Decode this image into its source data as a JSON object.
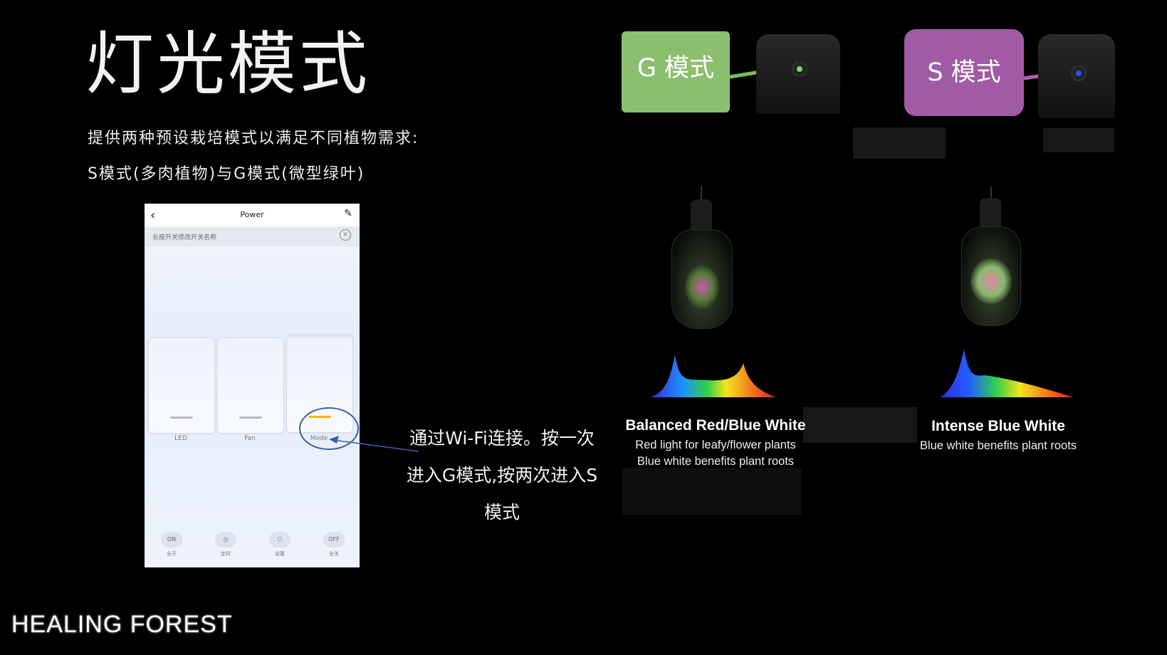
{
  "slide": {
    "title": "灯光模式",
    "subtitle_line1": "提供两种预设栽培模式以满足不同植物需求:",
    "subtitle_line2": "S模式(多肉植物)与G模式(微型绿叶)",
    "annotation": "通过Wi-Fi连接。按一次进入G模式,按两次进入S模式",
    "logo": "HEALING FOREST"
  },
  "phone": {
    "title": "Power",
    "hint": "长按开关修改开关名称",
    "switches": [
      {
        "label": "LED",
        "active": false
      },
      {
        "label": "Fan",
        "active": false
      },
      {
        "label": "Mode",
        "active": true
      }
    ],
    "bottom_bar": [
      {
        "icon": "ON",
        "label": "全开"
      },
      {
        "icon": "◷",
        "label": "定时"
      },
      {
        "icon": "⬡",
        "label": "设置"
      },
      {
        "icon": "OFF",
        "label": "全关"
      }
    ],
    "icons": {
      "back": "‹",
      "edit": "✎",
      "close": "✕"
    }
  },
  "modes": {
    "g": {
      "label": "G 模式",
      "color": "#8cbf6e",
      "led_color": "#7cd96a"
    },
    "s": {
      "label": "S 模式",
      "color": "#a05aa6",
      "led_color": "#2a4cff"
    }
  },
  "spectra": {
    "balanced": {
      "title": "Balanced Red/Blue White",
      "line1": "Red light for leafy/flower plants",
      "line2": "Blue white benefits plant roots"
    },
    "intense": {
      "title": "Intense Blue White",
      "line1": "Blue white benefits plant roots"
    }
  }
}
